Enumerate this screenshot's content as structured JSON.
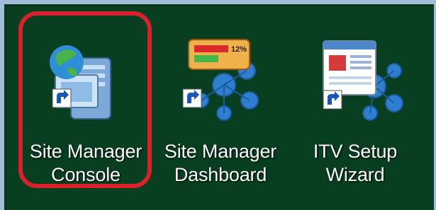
{
  "desktop": {
    "icons": [
      {
        "line1": "Site Manager",
        "line2": "Console"
      },
      {
        "line1": "Site Manager",
        "line2": "Dashboard",
        "gauge_text": "12%"
      },
      {
        "line1": "ITV Setup",
        "line2": "Wizard"
      }
    ],
    "highlight_color": "#d8212a",
    "background_color": "#073f20"
  }
}
